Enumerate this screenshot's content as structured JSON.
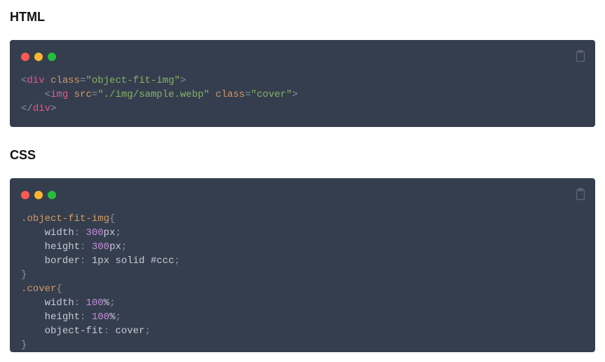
{
  "headings": {
    "html": "HTML",
    "css": "CSS"
  },
  "code": {
    "html": {
      "lines": [
        {
          "indent": 0,
          "t": "open",
          "tag": "div",
          "attrs": [
            {
              "name": "class",
              "value": "object-fit-img"
            }
          ]
        },
        {
          "indent": 1,
          "t": "void",
          "tag": "img",
          "attrs": [
            {
              "name": "src",
              "value": "./img/sample.webp"
            },
            {
              "name": "class",
              "value": "cover"
            }
          ]
        },
        {
          "indent": 0,
          "t": "close",
          "tag": "div"
        }
      ]
    },
    "css": {
      "rules": [
        {
          "selector": ".object-fit-img",
          "decls": [
            {
              "prop": "width",
              "value": "300",
              "unit": "px"
            },
            {
              "prop": "height",
              "value": "300",
              "unit": "px"
            },
            {
              "prop": "border",
              "raw_before_hex": "1px solid ",
              "hex": "#ccc"
            }
          ]
        },
        {
          "selector": ".cover",
          "decls": [
            {
              "prop": "width",
              "value": "100",
              "unit": "%"
            },
            {
              "prop": "height",
              "value": "100",
              "unit": "%"
            },
            {
              "prop": "object-fit",
              "keyword": "cover"
            }
          ]
        }
      ]
    }
  }
}
